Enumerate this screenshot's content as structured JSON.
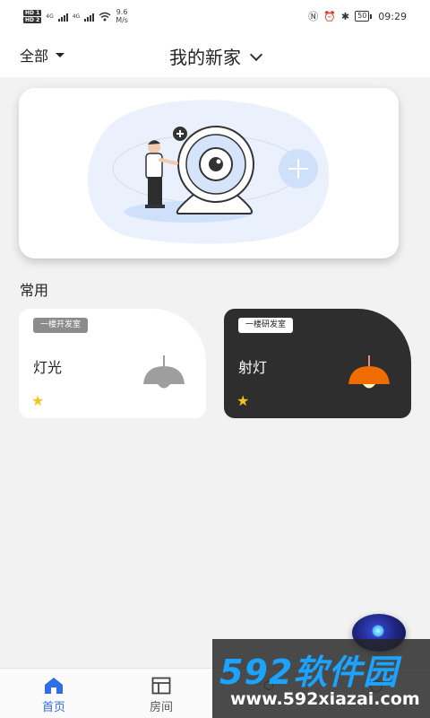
{
  "status_bar": {
    "sim1": "HD 1",
    "sim2": "HD 2",
    "net1": "4G",
    "net2": "4G",
    "speed_value": "9.6",
    "speed_unit": "M/s",
    "battery": "50",
    "time": "09:29"
  },
  "header": {
    "filter_label": "全部",
    "home_name": "我的新家"
  },
  "section": {
    "title": "常用"
  },
  "devices": [
    {
      "room": "一楼开发室",
      "name": "灯光",
      "favorite": true,
      "lamp_color": "#9e9e9e",
      "state": "off"
    },
    {
      "room": "一楼研发室",
      "name": "射灯",
      "favorite": true,
      "lamp_color": "#ef6c00",
      "state": "on"
    }
  ],
  "tabs": [
    {
      "label": "首页",
      "icon": "home-icon",
      "active": true
    },
    {
      "label": "房间",
      "icon": "room-layout-icon",
      "active": false
    },
    {
      "label": "",
      "icon": "cube-icon",
      "active": false
    },
    {
      "label": "",
      "icon": "profile-icon",
      "active": false
    }
  ],
  "watermark": {
    "brand": "592软件园",
    "url": "www.592xiazai.com"
  },
  "colors": {
    "accent": "#2f6ee8",
    "star": "#f5c518",
    "dark_card": "#2e2e2e"
  }
}
